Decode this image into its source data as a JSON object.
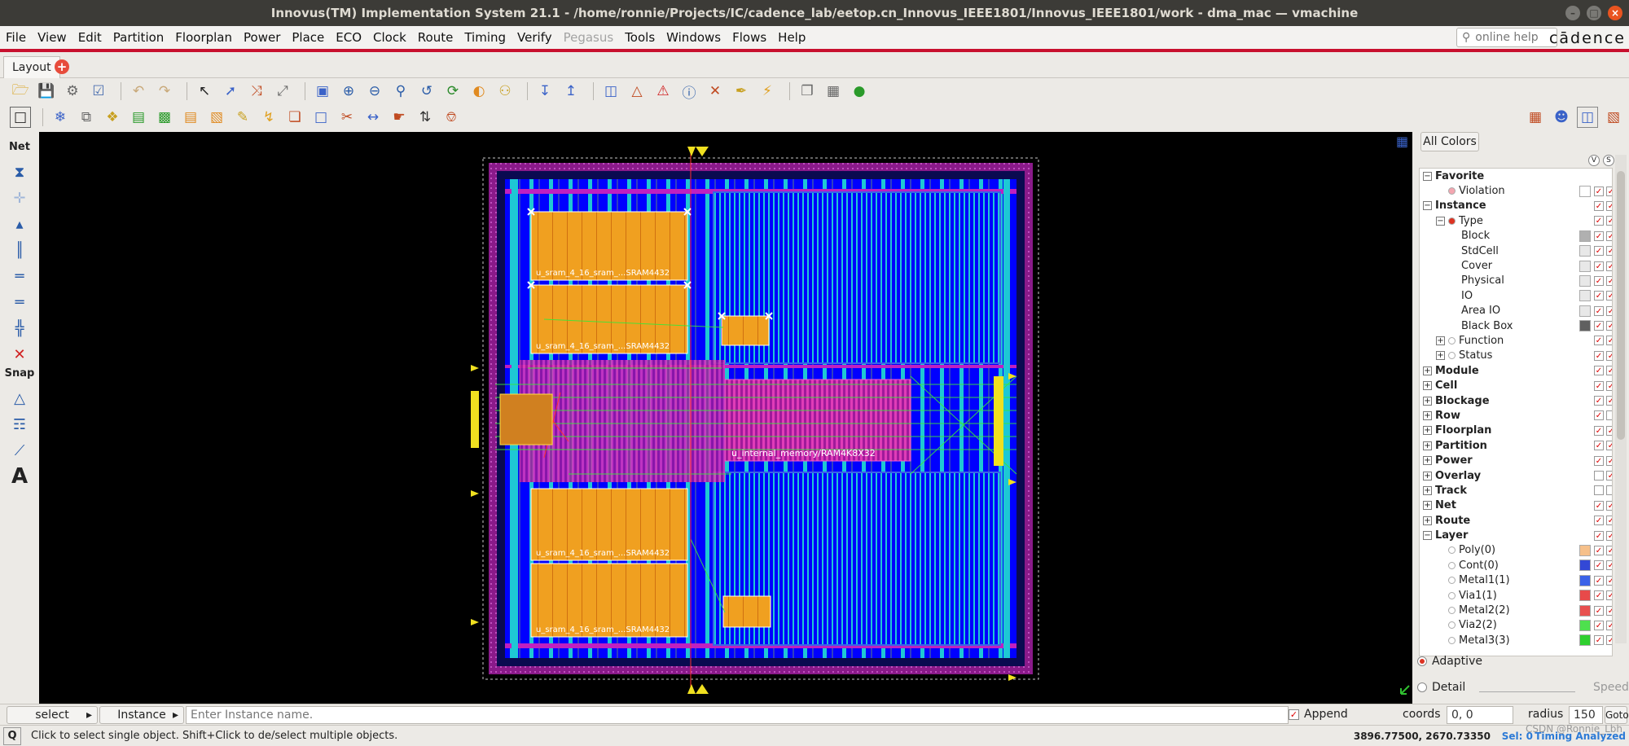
{
  "window": {
    "title": "Innovus(TM) Implementation System 21.1 - /home/ronnie/Projects/IC/cadence_lab/eetop.cn_Innovus_IEEE1801/Innovus_IEEE1801/work - dma_mac — vmachine",
    "minimize": "–",
    "maximize": "□",
    "close": "×"
  },
  "menubar": {
    "items": [
      "File",
      "View",
      "Edit",
      "Partition",
      "Floorplan",
      "Power",
      "Place",
      "ECO",
      "Clock",
      "Route",
      "Timing",
      "Verify",
      "Pegasus",
      "Tools",
      "Windows",
      "Flows",
      "Help"
    ],
    "disabled": [
      "Pegasus"
    ],
    "help_placeholder": "online help",
    "brand": "cādence"
  },
  "tabs": {
    "active": "Layout",
    "add": "+"
  },
  "sidebar": {
    "net_label": "Net",
    "snap_label": "Snap",
    "text_tool": "A"
  },
  "layout": {
    "instances": [
      "u_sram_4_16_sram_...SRAM4432",
      "u_sram_4_16_sram_...SRAM4432",
      "u_sram_4_16_sram_...SRAM4432",
      "u_sram_4_16_sram_...SRAM4432",
      "u_internal_memory/RAM4K8X32"
    ]
  },
  "right_panel": {
    "all_colors": "All Colors",
    "tree": [
      {
        "label": "Favorite",
        "level": 0,
        "bold": true,
        "exp": "−"
      },
      {
        "label": "Violation",
        "level": 1,
        "dot": "#f4a6b0",
        "sw": "#ffffff",
        "c1": true,
        "c2": true
      },
      {
        "label": "Instance",
        "level": 0,
        "bold": true,
        "exp": "−",
        "c1": true,
        "c2": true
      },
      {
        "label": "Type",
        "level": 1,
        "exp": "−",
        "dot": "#d32",
        "c1": true,
        "c2": true
      },
      {
        "label": "Block",
        "level": 2,
        "sw": "#b0b0b0",
        "c1": true,
        "c2": true
      },
      {
        "label": "StdCell",
        "level": 2,
        "sw": "#e8e8e8",
        "c1": true,
        "c2": true
      },
      {
        "label": "Cover",
        "level": 2,
        "sw": "#e8e8e8",
        "c1": true,
        "c2": true
      },
      {
        "label": "Physical",
        "level": 2,
        "sw": "#e8e8e8",
        "c1": true,
        "c2": true
      },
      {
        "label": "IO",
        "level": 2,
        "sw": "#e8e8e8",
        "c1": true,
        "c2": true
      },
      {
        "label": "Area IO",
        "level": 2,
        "sw": "#e8e8e8",
        "c1": true,
        "c2": true
      },
      {
        "label": "Black Box",
        "level": 2,
        "sw": "#606060",
        "c1": true,
        "c2": true
      },
      {
        "label": "Function",
        "level": 1,
        "exp": "+",
        "dot": "#ffffff",
        "c1": true,
        "c2": true
      },
      {
        "label": "Status",
        "level": 1,
        "exp": "+",
        "dot": "#ffffff",
        "c1": true,
        "c2": true
      },
      {
        "label": "Module",
        "level": 0,
        "bold": true,
        "exp": "+",
        "c1": true,
        "c2": true
      },
      {
        "label": "Cell",
        "level": 0,
        "bold": true,
        "exp": "+",
        "c1": true,
        "c2": true
      },
      {
        "label": "Blockage",
        "level": 0,
        "bold": true,
        "exp": "+",
        "c1": true,
        "c2": true
      },
      {
        "label": "Row",
        "level": 0,
        "bold": true,
        "exp": "+",
        "c1": true,
        "c2": false
      },
      {
        "label": "Floorplan",
        "level": 0,
        "bold": true,
        "exp": "+",
        "c1": true,
        "c2": true
      },
      {
        "label": "Partition",
        "level": 0,
        "bold": true,
        "exp": "+",
        "c1": true,
        "c2": true
      },
      {
        "label": "Power",
        "level": 0,
        "bold": true,
        "exp": "+",
        "c1": true,
        "c2": true
      },
      {
        "label": "Overlay",
        "level": 0,
        "bold": true,
        "exp": "+",
        "c1": false,
        "c2": true
      },
      {
        "label": "Track",
        "level": 0,
        "bold": true,
        "exp": "+",
        "c1": false,
        "c2": false
      },
      {
        "label": "Net",
        "level": 0,
        "bold": true,
        "exp": "+",
        "c1": true,
        "c2": true
      },
      {
        "label": "Route",
        "level": 0,
        "bold": true,
        "exp": "+",
        "c1": true,
        "c2": true
      },
      {
        "label": "Layer",
        "level": 0,
        "bold": true,
        "exp": "−",
        "c1": true,
        "c2": true
      },
      {
        "label": "Poly(0)",
        "level": 1,
        "dot": "#ffffff",
        "sw": "#f6c08a",
        "c1": true,
        "c2": true
      },
      {
        "label": "Cont(0)",
        "level": 1,
        "dot": "#ffffff",
        "sw": "#3348d6",
        "c1": true,
        "c2": true
      },
      {
        "label": "Metal1(1)",
        "level": 1,
        "dot": "#ffffff",
        "sw": "#3a62e8",
        "c1": true,
        "c2": true
      },
      {
        "label": "Via1(1)",
        "level": 1,
        "dot": "#ffffff",
        "sw": "#e84a4a",
        "c1": true,
        "c2": true
      },
      {
        "label": "Metal2(2)",
        "level": 1,
        "dot": "#ffffff",
        "sw": "#e85050",
        "c1": true,
        "c2": true
      },
      {
        "label": "Via2(2)",
        "level": 1,
        "dot": "#ffffff",
        "sw": "#4ee04e",
        "c1": true,
        "c2": true
      },
      {
        "label": "Metal3(3)",
        "level": 1,
        "dot": "#ffffff",
        "sw": "#2fd02f",
        "c1": true,
        "c2": true
      }
    ],
    "adaptive": "Adaptive",
    "detail": "Detail",
    "speed": "Speed"
  },
  "bottom": {
    "select": "select",
    "instance": "Instance",
    "instance_placeholder": "Enter Instance name.",
    "append": "Append",
    "coords_label": "coords",
    "coords_value": "0, 0",
    "radius_label": "radius",
    "radius_value": "150",
    "goto": "Goto"
  },
  "status": {
    "q": "Q",
    "message": "Click to select single object. Shift+Click to de/select multiple objects.",
    "cursor": "3896.77500, 2670.73350",
    "sel": "Sel: 0",
    "timing": "Timing Analyzed",
    "watermark": "CSDN @Ronnie_Lbh"
  },
  "colors": {
    "canvas": "#000000",
    "core": "#0000ff",
    "stripe": "#1ec8d4",
    "macro": "#f0a020",
    "ring": "#c020c0"
  }
}
